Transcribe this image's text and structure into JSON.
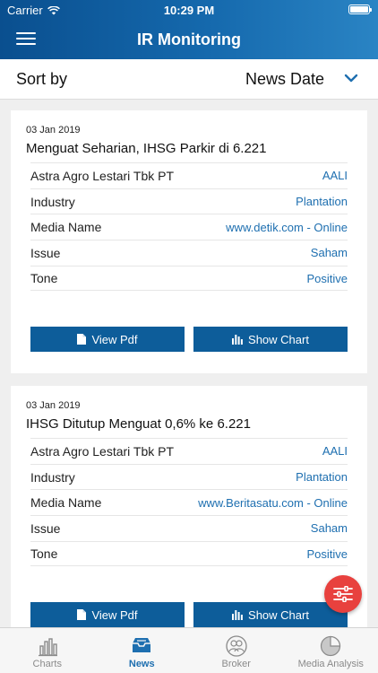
{
  "status": {
    "carrier": "Carrier",
    "time": "10:29 PM",
    "battery_level": 0.9
  },
  "app": {
    "title": "IR Monitoring"
  },
  "sort": {
    "label": "Sort by",
    "value": "News Date"
  },
  "cards": [
    {
      "date": "03 Jan 2019",
      "title": "Menguat Seharian, IHSG Parkir di 6.221",
      "rows": [
        {
          "label": "Astra Agro Lestari Tbk PT",
          "value": "AALI"
        },
        {
          "label": "Industry",
          "value": "Plantation"
        },
        {
          "label": "Media Name",
          "value": "www.detik.com - Online"
        },
        {
          "label": "Issue",
          "value": "Saham"
        },
        {
          "label": "Tone",
          "value": "Positive"
        }
      ],
      "view_pdf": "View Pdf",
      "show_chart": "Show Chart"
    },
    {
      "date": "03 Jan 2019",
      "title": "IHSG Ditutup Menguat 0,6% ke 6.221",
      "rows": [
        {
          "label": "Astra Agro Lestari Tbk PT",
          "value": "AALI"
        },
        {
          "label": "Industry",
          "value": "Plantation"
        },
        {
          "label": "Media Name",
          "value": "www.Beritasatu.com - Online"
        },
        {
          "label": "Issue",
          "value": "Saham"
        },
        {
          "label": "Tone",
          "value": "Positive"
        }
      ],
      "view_pdf": "View Pdf",
      "show_chart": "Show Chart"
    }
  ],
  "tabs": [
    {
      "label": "Charts",
      "icon": "bar-chart-icon",
      "active": false
    },
    {
      "label": "News",
      "icon": "inbox-icon",
      "active": true
    },
    {
      "label": "Broker",
      "icon": "users-icon",
      "active": false
    },
    {
      "label": "Media Analysis",
      "icon": "pie-chart-icon",
      "active": false
    }
  ],
  "colors": {
    "header": "#0a4f8f",
    "accent": "#1e6fb0",
    "button": "#0d5d9a",
    "fab": "#e8413e"
  }
}
